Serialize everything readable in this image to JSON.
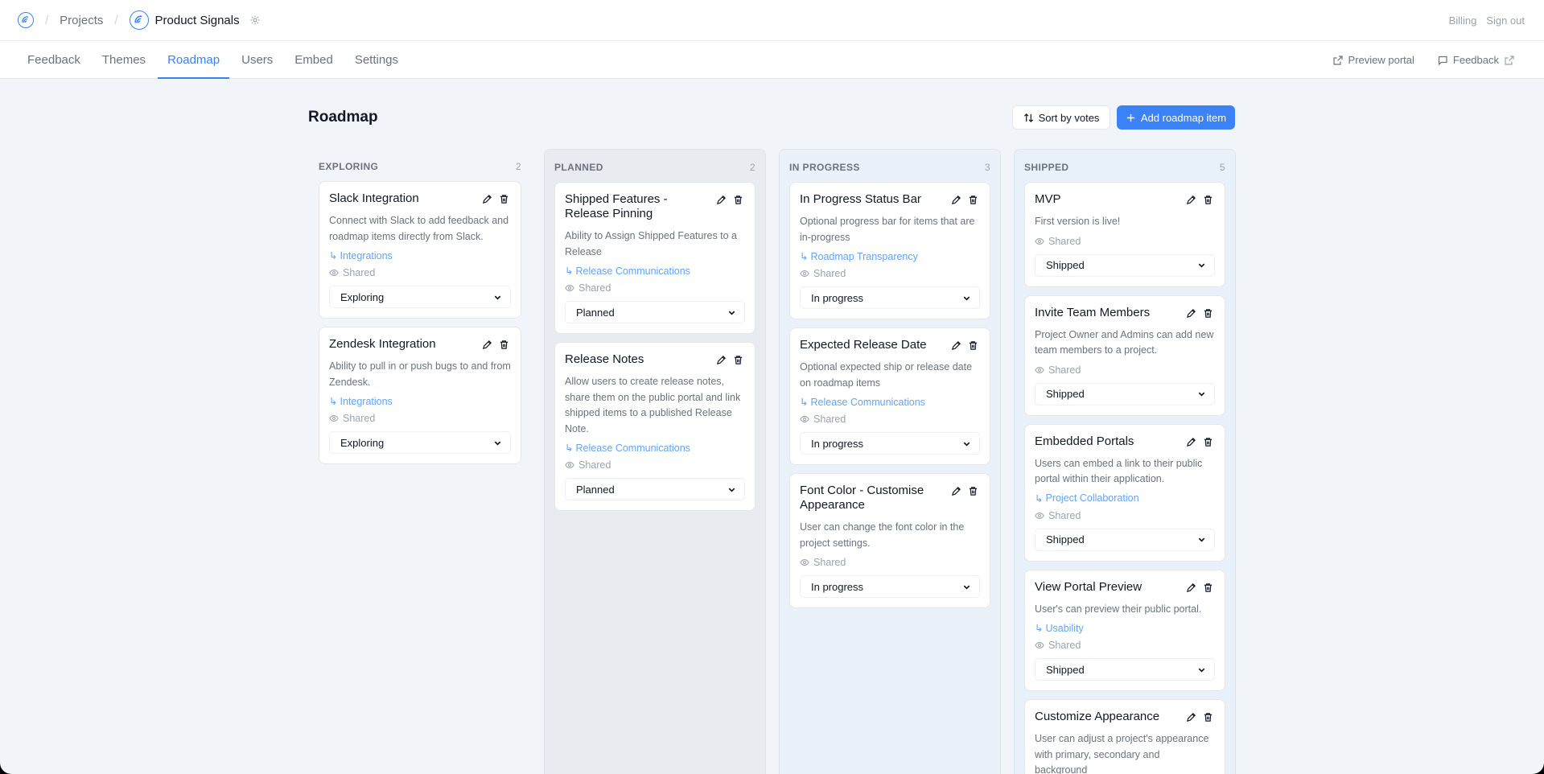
{
  "breadcrumb": {
    "projects": "Projects",
    "project_name": "Product Signals"
  },
  "top_links": {
    "billing": "Billing",
    "sign_out": "Sign out"
  },
  "nav": {
    "tabs": [
      "Feedback",
      "Themes",
      "Roadmap",
      "Users",
      "Embed",
      "Settings"
    ],
    "active": "Roadmap",
    "preview_portal": "Preview portal",
    "feedback_link": "Feedback"
  },
  "page": {
    "title": "Roadmap",
    "sort_label": "Sort by votes",
    "add_label": "Add roadmap item"
  },
  "columns": [
    {
      "name": "EXPLORING",
      "count": "2",
      "cards": [
        {
          "title": "Slack Integration",
          "desc": "Connect with Slack to add feedback and roadmap items directly from Slack.",
          "theme": "Integrations",
          "shared": "Shared",
          "status": "Exploring"
        },
        {
          "title": "Zendesk Integration",
          "desc": "Ability to pull in or push bugs to and from Zendesk.",
          "theme": "Integrations",
          "shared": "Shared",
          "status": "Exploring"
        }
      ]
    },
    {
      "name": "PLANNED",
      "count": "2",
      "cards": [
        {
          "title": "Shipped Features - Release Pinning",
          "desc": "Ability to Assign Shipped Features to a Release",
          "theme": "Release Communications",
          "shared": "Shared",
          "status": "Planned"
        },
        {
          "title": "Release Notes",
          "desc": "Allow users to create release notes, share them on the public portal and link shipped items to a published Release Note.",
          "theme": "Release Communications",
          "shared": "Shared",
          "status": "Planned"
        }
      ]
    },
    {
      "name": "IN PROGRESS",
      "count": "3",
      "cards": [
        {
          "title": "In Progress Status Bar",
          "desc": "Optional progress bar for items that are in-progress",
          "theme": "Roadmap Transparency",
          "shared": "Shared",
          "status": "In progress"
        },
        {
          "title": "Expected Release Date",
          "desc": "Optional expected ship or release date on roadmap items",
          "theme": "Release Communications",
          "shared": "Shared",
          "status": "In progress"
        },
        {
          "title": "Font Color - Customise Appearance",
          "desc": "User can change the font color in the project settings.",
          "theme": "",
          "shared": "Shared",
          "status": "In progress"
        }
      ]
    },
    {
      "name": "SHIPPED",
      "count": "5",
      "cards": [
        {
          "title": "MVP",
          "desc": "First version is live!",
          "theme": "",
          "shared": "Shared",
          "status": "Shipped"
        },
        {
          "title": "Invite Team Members",
          "desc": "Project Owner and Admins can add new team members to a project.",
          "theme": "",
          "shared": "Shared",
          "status": "Shipped"
        },
        {
          "title": "Embedded Portals",
          "desc": "Users can embed a link to their public portal within their application.",
          "theme": "Project Collaboration",
          "shared": "Shared",
          "status": "Shipped"
        },
        {
          "title": "View Portal Preview",
          "desc": "User's can preview their public portal.",
          "theme": "Usability",
          "shared": "Shared",
          "status": "Shipped"
        },
        {
          "title": "Customize Appearance",
          "desc": "User can adjust a project's appearance with primary, secondary and background",
          "theme": "",
          "shared": "",
          "status": ""
        }
      ]
    }
  ],
  "colors": {
    "accent": "#3b82f6",
    "theme_link": "#60a5fa"
  }
}
